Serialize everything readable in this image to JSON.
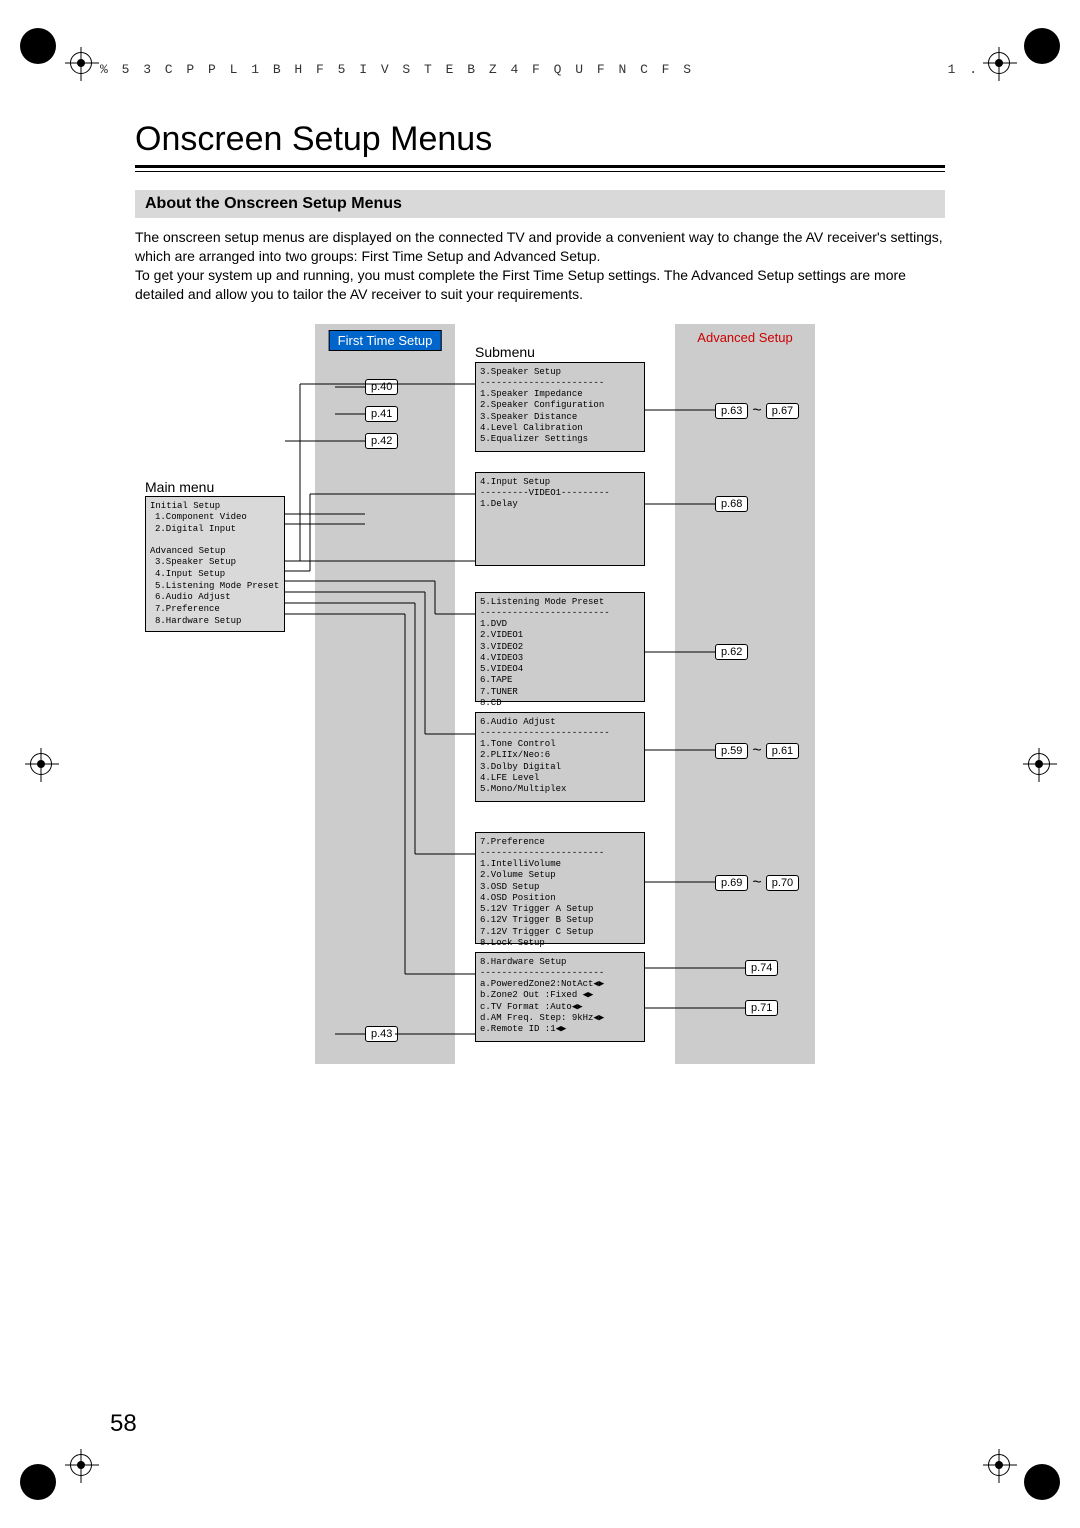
{
  "header": {
    "code": "% 5 3   C P P L  1 B H F   5 I V S T E B Z  4 F Q U F N C F S",
    "right": "1 ."
  },
  "page_title": "Onscreen Setup Menus",
  "section_title": "About the Onscreen Setup Menus",
  "intro_text": "The onscreen setup menus are displayed on the connected TV and provide a convenient way to change the AV receiver's settings, which are arranged into two groups: First Time Setup and Advanced Setup.\nTo get your system up and running, you must complete the First Time Setup settings. The Advanced Setup settings are more detailed and allow you to tailor the AV receiver to suit your requirements.",
  "diagram": {
    "first_time_label": "First Time Setup",
    "advanced_label": "Advanced Setup",
    "submenu_label": "Submenu",
    "main_menu_label": "Main menu",
    "main_menu": {
      "initial": "Initial Setup",
      "items_initial": [
        "1.Component Video",
        "2.Digital Input"
      ],
      "advanced": "Advanced Setup",
      "items_advanced": [
        "3.Speaker Setup",
        "4.Input Setup",
        "5.Listening Mode Preset",
        "6.Audio Adjust",
        "7.Preference",
        "8.Hardware Setup"
      ]
    },
    "first_refs": [
      "p.40",
      "p.41",
      "p.42",
      "p.43"
    ],
    "submenus": [
      {
        "title": "3.Speaker Setup",
        "items": [
          "1.Speaker Impedance",
          "2.Speaker Configuration",
          "3.Speaker Distance",
          "4.Level Calibration",
          "5.Equalizer Settings"
        ],
        "refs": [
          "p.63",
          "~",
          "p.67"
        ]
      },
      {
        "title": "4.Input Setup",
        "subtitle": "---------VIDEO1---------",
        "items": [
          "1.Delay"
        ],
        "refs": [
          "p.68"
        ]
      },
      {
        "title": "5.Listening Mode Preset",
        "items": [
          "1.DVD",
          "2.VIDEO1",
          "3.VIDEO2",
          "4.VIDEO3",
          "5.VIDEO4",
          "6.TAPE",
          "7.TUNER",
          "8.CD"
        ],
        "refs": [
          "p.62"
        ]
      },
      {
        "title": "6.Audio Adjust",
        "items": [
          "1.Tone Control",
          "2.PLIIx/Neo:6",
          "3.Dolby Digital",
          "4.LFE Level",
          "5.Mono/Multiplex"
        ],
        "refs": [
          "p.59",
          "~",
          "p.61"
        ]
      },
      {
        "title": "7.Preference",
        "items": [
          "1.IntelliVolume",
          "2.Volume Setup",
          "3.OSD Setup",
          "4.OSD Position",
          "5.12V Trigger A Setup",
          "6.12V Trigger B Setup",
          "7.12V Trigger C Setup",
          "8.Lock Setup"
        ],
        "refs": [
          "p.69",
          "~",
          "p.70"
        ]
      },
      {
        "title": "8.Hardware Setup",
        "items": [
          "a.PoweredZone2:NotAct◀▶",
          "b.Zone2 Out :Fixed  ◀▶",
          "c.TV Format    :Auto◀▶",
          "d.AM Freq. Step: 9kHz◀▶",
          "e.Remote ID      :1◀▶"
        ],
        "refs": [
          "p.74",
          "p.71"
        ]
      }
    ]
  },
  "page_number": "58"
}
